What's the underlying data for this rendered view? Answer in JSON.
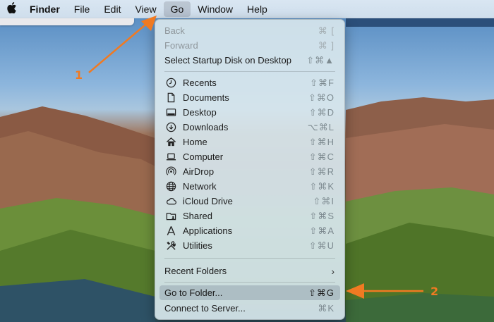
{
  "menubar": {
    "apple_icon": "apple-logo",
    "app_name": "Finder",
    "items": [
      "File",
      "Edit",
      "View",
      "Go",
      "Window",
      "Help"
    ],
    "active_item": "Go"
  },
  "go_menu": {
    "back": {
      "label": "Back",
      "shortcut": "⌘ ["
    },
    "forward": {
      "label": "Forward",
      "shortcut": "⌘ ]"
    },
    "startup_disk": {
      "label": "Select Startup Disk on Desktop",
      "shortcut": "⇧⌘▲"
    },
    "places": [
      {
        "label": "Recents",
        "shortcut": "⇧⌘F",
        "icon": "clock-icon"
      },
      {
        "label": "Documents",
        "shortcut": "⇧⌘O",
        "icon": "document-icon"
      },
      {
        "label": "Desktop",
        "shortcut": "⇧⌘D",
        "icon": "desktop-icon"
      },
      {
        "label": "Downloads",
        "shortcut": "⌥⌘L",
        "icon": "download-icon"
      },
      {
        "label": "Home",
        "shortcut": "⇧⌘H",
        "icon": "home-icon"
      },
      {
        "label": "Computer",
        "shortcut": "⇧⌘C",
        "icon": "laptop-icon"
      },
      {
        "label": "AirDrop",
        "shortcut": "⇧⌘R",
        "icon": "airdrop-icon"
      },
      {
        "label": "Network",
        "shortcut": "⇧⌘K",
        "icon": "globe-icon"
      },
      {
        "label": "iCloud Drive",
        "shortcut": "⇧⌘I",
        "icon": "cloud-icon"
      },
      {
        "label": "Shared",
        "shortcut": "⇧⌘S",
        "icon": "shared-folder-icon"
      },
      {
        "label": "Applications",
        "shortcut": "⇧⌘A",
        "icon": "applications-icon"
      },
      {
        "label": "Utilities",
        "shortcut": "⇧⌘U",
        "icon": "utilities-icon"
      }
    ],
    "recent_folders": {
      "label": "Recent Folders",
      "chevron": "›"
    },
    "go_to_folder": {
      "label": "Go to Folder...",
      "shortcut": "⇧⌘G"
    },
    "connect_to_server": {
      "label": "Connect to Server...",
      "shortcut": "⌘K"
    }
  },
  "annotations": {
    "step1": "1",
    "step2": "2",
    "color": "#f07a22"
  }
}
